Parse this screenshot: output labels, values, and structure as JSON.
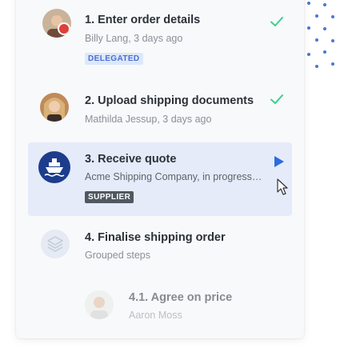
{
  "steps": [
    {
      "title": "1. Enter order details",
      "subtitle": "Billy Lang, 3 days ago",
      "badge": "DELEGATED",
      "status": "check-icon"
    },
    {
      "title": "2. Upload shipping documents",
      "subtitle": "Mathilda Jessup, 3 days ago",
      "status": "check-icon"
    },
    {
      "title": "3. Receive quote",
      "subtitle": "Acme Shipping Company, in progress…",
      "badge": "SUPPLIER",
      "status": "play-icon"
    },
    {
      "title": "4. Finalise shipping order",
      "subtitle": "Grouped steps"
    },
    {
      "title": "4.1. Agree on price",
      "subtitle": "Aaron Moss"
    }
  ],
  "colors": {
    "accent": "#2d6ce0",
    "check": "#3ccf8e",
    "ship_circle": "#1c3d8c",
    "highlight": "#e5ebf9",
    "badge_delegated_bg": "#dde8fb",
    "badge_supplier_bg": "#505861"
  }
}
